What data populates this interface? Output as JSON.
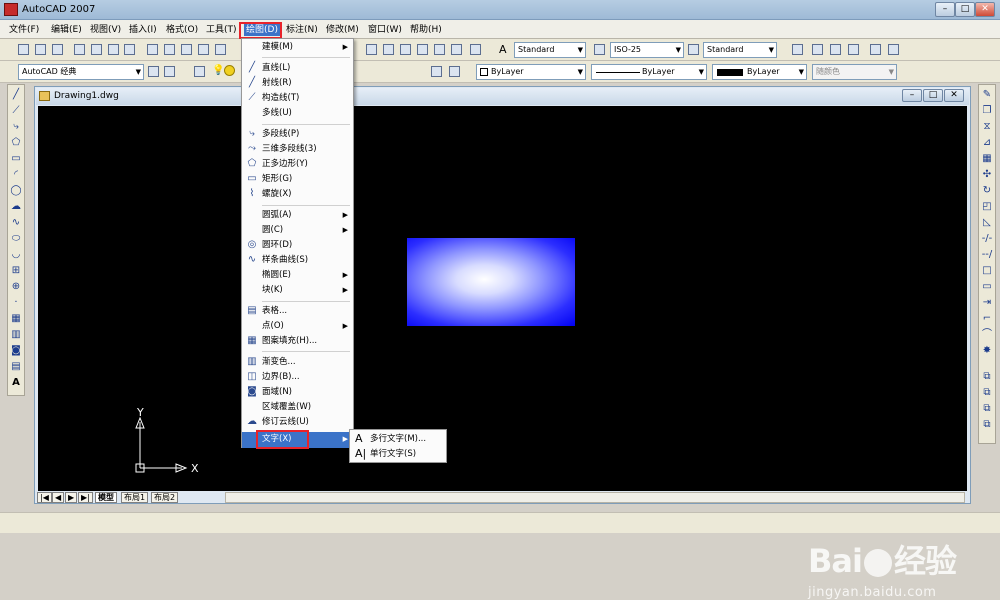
{
  "window": {
    "title": "AutoCAD 2007",
    "controls": {
      "minimize": "–",
      "restore": "□",
      "close": "✕"
    }
  },
  "menubar": {
    "items": [
      "文件(F)",
      "编辑(E)",
      "视图(V)",
      "插入(I)",
      "格式(O)",
      "工具(T)",
      "绘图(D)",
      "标注(N)",
      "修改(M)",
      "窗口(W)",
      "帮助(H)"
    ],
    "highlighted": "绘图(D)"
  },
  "toolbar_styles": {
    "text_style": "Standard",
    "dim_style": "ISO-25",
    "table_style": "Standard"
  },
  "toolbar_layers": {
    "workspace": "AutoCAD 经典",
    "color": "ByLayer",
    "linetype": "ByLayer",
    "lineweight": "ByLayer",
    "plot_style": "随颜色"
  },
  "drawing": {
    "title": "Drawing1.dwg",
    "ucs_x": "X",
    "ucs_y": "Y",
    "gradient_colors": [
      "#ffffff",
      "#0000f2"
    ]
  },
  "layout_tabs": [
    "模型",
    "布局1",
    "布局2"
  ],
  "draw_menu": {
    "items": [
      {
        "label": "建模(M)",
        "icon": "",
        "submenu": true
      },
      {
        "label": "直线(L)",
        "icon": "line-icon",
        "submenu": false
      },
      {
        "label": "射线(R)",
        "icon": "ray-icon",
        "submenu": false
      },
      {
        "label": "构造线(T)",
        "icon": "xline-icon",
        "submenu": false
      },
      {
        "label": "多线(U)",
        "icon": "",
        "submenu": false
      },
      {
        "label": "多段线(P)",
        "icon": "polyline-icon",
        "submenu": false
      },
      {
        "label": "三维多段线(3)",
        "icon": "3dpolyline-icon",
        "submenu": false
      },
      {
        "label": "正多边形(Y)",
        "icon": "polygon-icon",
        "submenu": false
      },
      {
        "label": "矩形(G)",
        "icon": "rectangle-icon",
        "submenu": false
      },
      {
        "label": "螺旋(X)",
        "icon": "helix-icon",
        "submenu": false
      },
      {
        "label": "圆弧(A)",
        "icon": "",
        "submenu": true
      },
      {
        "label": "圆(C)",
        "icon": "",
        "submenu": true
      },
      {
        "label": "圆环(D)",
        "icon": "donut-icon",
        "submenu": false
      },
      {
        "label": "样条曲线(S)",
        "icon": "spline-icon",
        "submenu": false
      },
      {
        "label": "椭圆(E)",
        "icon": "",
        "submenu": true
      },
      {
        "label": "块(K)",
        "icon": "",
        "submenu": true
      },
      {
        "label": "表格...",
        "icon": "table-icon",
        "submenu": false
      },
      {
        "label": "点(O)",
        "icon": "",
        "submenu": true
      },
      {
        "label": "图案填充(H)...",
        "icon": "hatch-icon",
        "submenu": false
      },
      {
        "label": "渐变色...",
        "icon": "gradient-icon",
        "submenu": false
      },
      {
        "label": "边界(B)...",
        "icon": "boundary-icon",
        "submenu": false
      },
      {
        "label": "面域(N)",
        "icon": "region-icon",
        "submenu": false
      },
      {
        "label": "区域覆盖(W)",
        "icon": "",
        "submenu": false
      },
      {
        "label": "修订云线(U)",
        "icon": "revcloud-icon",
        "submenu": false
      },
      {
        "label": "文字(X)",
        "icon": "",
        "submenu": true
      }
    ]
  },
  "text_submenu": {
    "items": [
      {
        "label": "多行文字(M)...",
        "icon": "mtext-icon"
      },
      {
        "label": "单行文字(S)",
        "icon": "dtext-icon"
      }
    ]
  },
  "watermark": {
    "brand": "Bai",
    "brand_suffix": "经验",
    "url": "jingyan.baidu.com"
  }
}
